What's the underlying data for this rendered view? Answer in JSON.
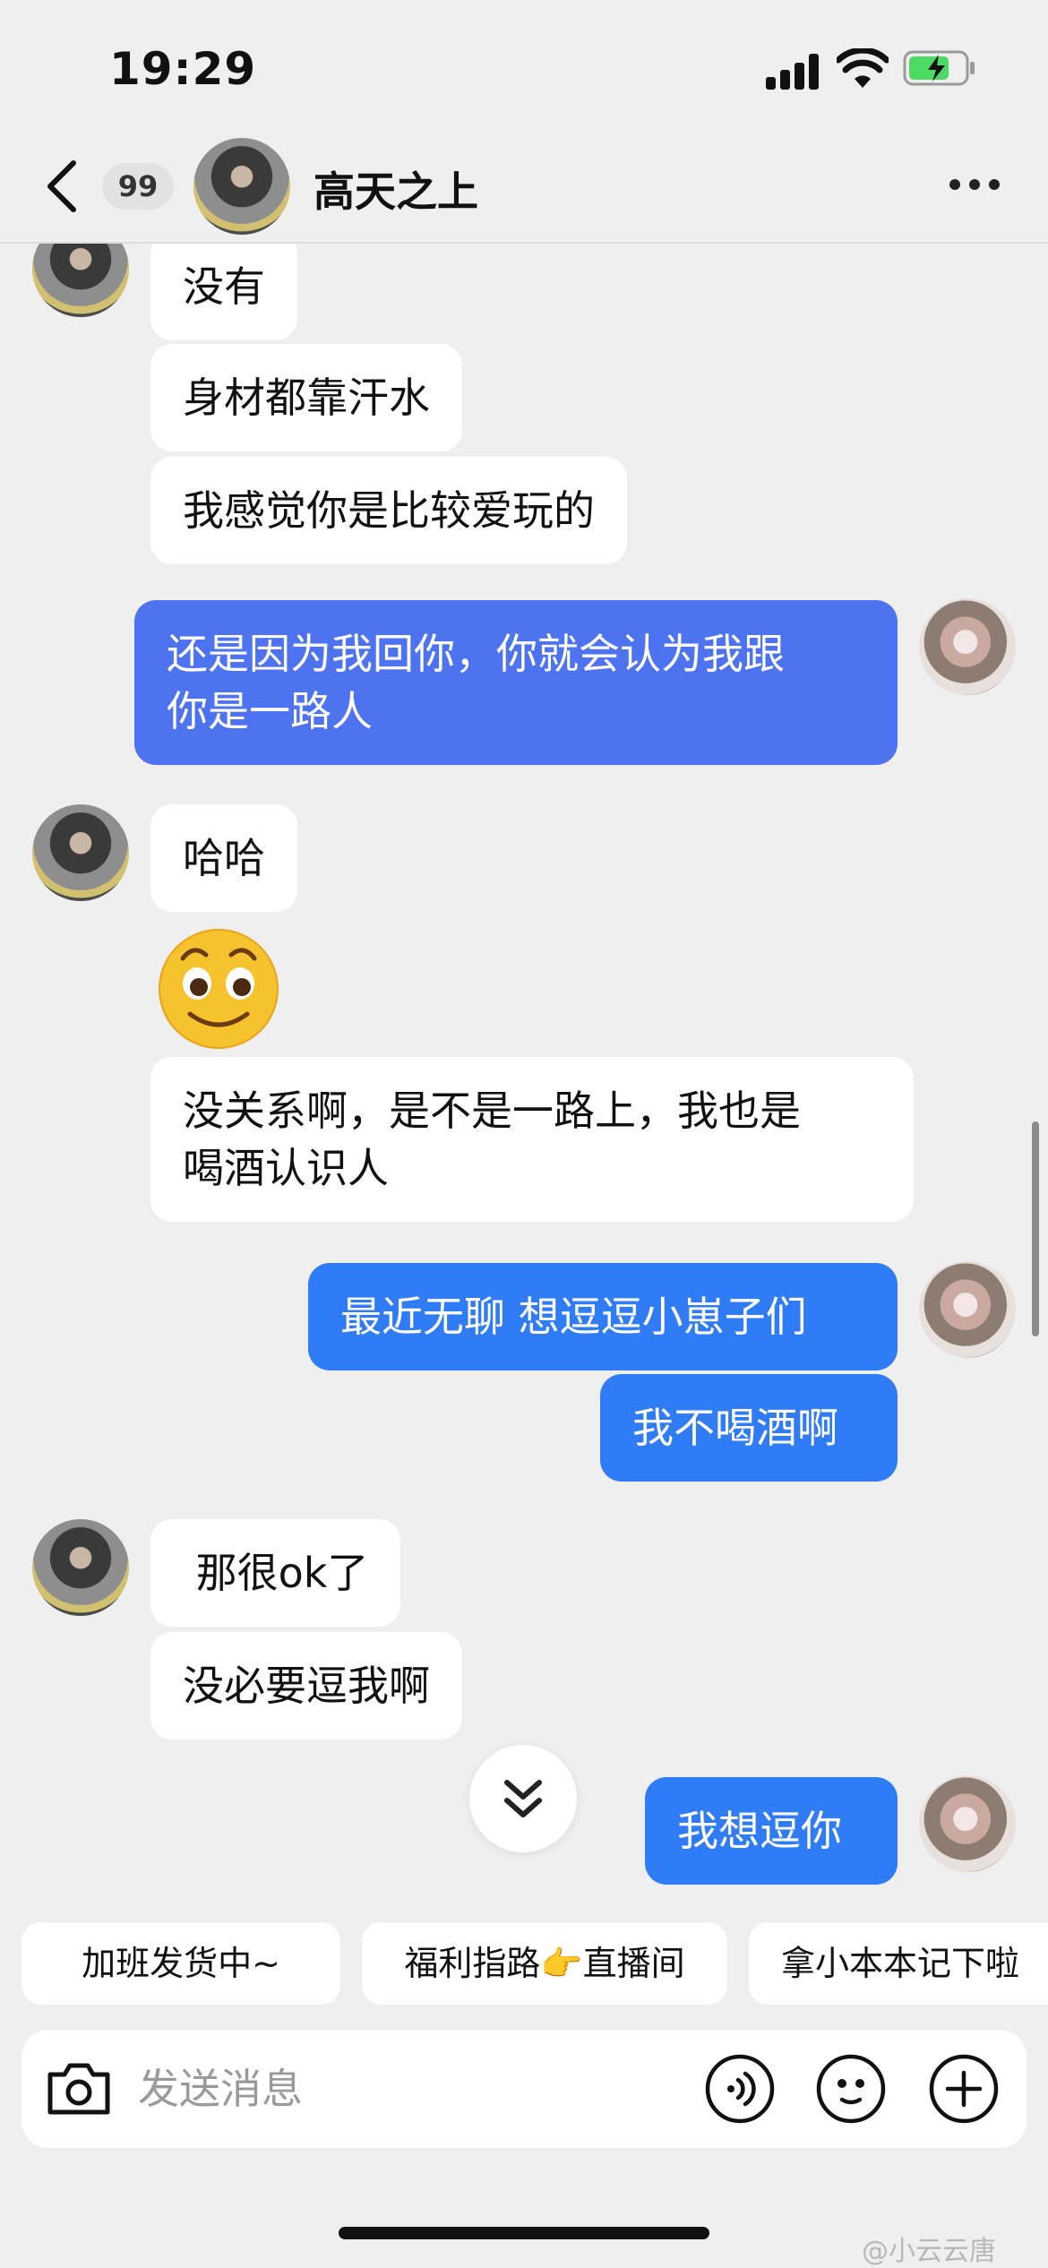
{
  "status": {
    "time": "19:29"
  },
  "header": {
    "unread_count": "99",
    "contact_name": "高天之上"
  },
  "messages": [
    {
      "from": "other",
      "text": "没有"
    },
    {
      "from": "other",
      "text": "身材都靠汗水"
    },
    {
      "from": "other",
      "text": "我感觉你是比较爱玩的"
    },
    {
      "from": "self",
      "text": "还是因为我回你，你就会认为我跟\n你是一路人"
    },
    {
      "from": "other",
      "text": "哈哈"
    },
    {
      "from": "other",
      "type": "emoji",
      "emoji": "grinning-face-sticker"
    },
    {
      "from": "other",
      "text": "没关系啊，是不是一路上，我也是\n喝酒认识人"
    },
    {
      "from": "self",
      "text": "最近无聊 想逗逗小崽子们"
    },
    {
      "from": "self",
      "text": "我不喝酒啊"
    },
    {
      "from": "other",
      "text": " 那很ok了"
    },
    {
      "from": "other",
      "text": "没必要逗我啊"
    },
    {
      "from": "self",
      "text": "我想逗你"
    }
  ],
  "quick_replies": [
    "加班发货中~",
    "福利指路👉直播间",
    "拿小本本记下啦"
  ],
  "composer": {
    "placeholder": "发送消息"
  },
  "watermark": "@小云云唐",
  "colors": {
    "outgoing": "#2f7cf6",
    "incoming": "#ffffff",
    "background": "#efefef"
  }
}
